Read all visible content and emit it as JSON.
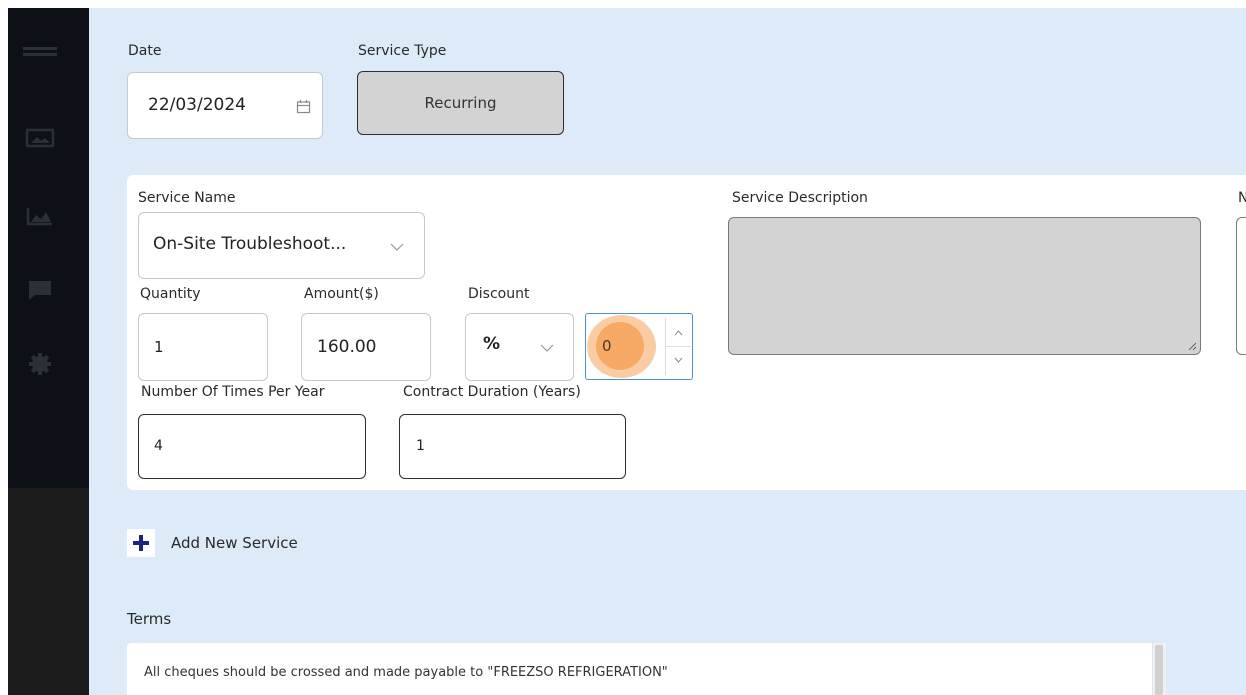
{
  "sidebar": {
    "icons": [
      "menu-icon",
      "image-icon",
      "chart-icon",
      "message-icon",
      "gear-icon"
    ]
  },
  "date": {
    "label": "Date",
    "value": "22/03/2024"
  },
  "service_type": {
    "label": "Service Type",
    "value": "Recurring"
  },
  "service": {
    "name_label": "Service Name",
    "name_value": "On-Site Troubleshoot...",
    "description_label": "Service Description",
    "next_label_fragment": "N",
    "quantity_label": "Quantity",
    "quantity_value": "1",
    "amount_label": "Amount($)",
    "amount_value": "160.00",
    "discount_label": "Discount",
    "discount_type": "%",
    "discount_value": "0",
    "times_label": "Number Of Times Per Year",
    "times_value": "4",
    "duration_label": "Contract Duration (Years)",
    "duration_value": "1"
  },
  "add_service": {
    "label": "Add New Service"
  },
  "terms": {
    "label": "Terms",
    "text": "All cheques should be crossed and made payable to \"FREEZSO REFRIGERATION\""
  },
  "colors": {
    "sidebar": "#0d1117",
    "main_bg": "#dcebf7",
    "accent_blue": "#4a90d9",
    "highlight_orange": "#f5a35a",
    "add_icon": "#1a237e"
  }
}
